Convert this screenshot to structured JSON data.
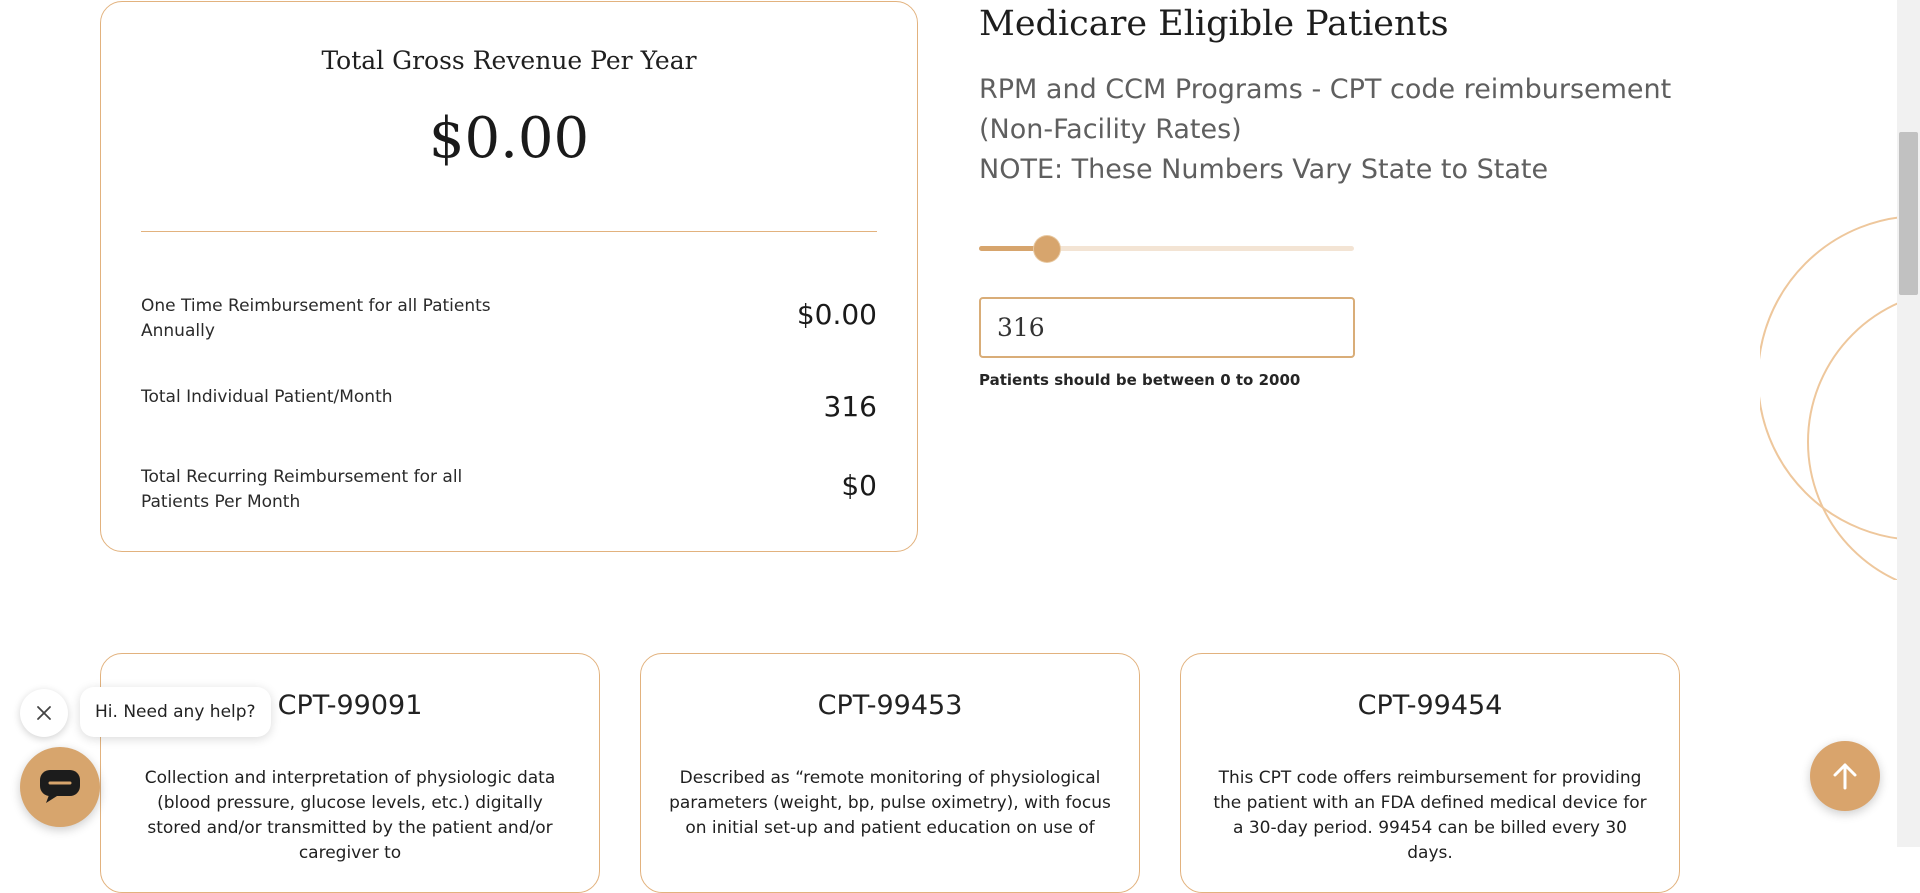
{
  "summary": {
    "title": "Total Gross Revenue Per Year",
    "amount": "$0.00",
    "rows": [
      {
        "label": "One Time Reimbursement for all Patients Annually",
        "value": "$0.00"
      },
      {
        "label": "Total Individual Patient/Month",
        "value": "316"
      },
      {
        "label": "Total Recurring Reimbursement for all Patients Per Month",
        "value": "$0"
      }
    ]
  },
  "medicare": {
    "title": "Medicare Eligible Patients",
    "program_line1": "RPM and CCM Programs - CPT code reimbursement (Non-Facility Rates)",
    "program_line2": "NOTE: These Numbers Vary State to State",
    "slider": {
      "min": 0,
      "max": 2000,
      "value": 316
    },
    "patients_value": "316",
    "hint": "Patients should be between 0 to 2000"
  },
  "cpt_cards": [
    {
      "code": "CPT-99091",
      "description": "Collection and interpretation of physiologic data (blood pressure, glucose levels, etc.) digitally stored and/or transmitted by the patient and/or caregiver to"
    },
    {
      "code": "CPT-99453",
      "description": "Described as “remote monitoring of physiological parameters (weight, bp, pulse oximetry), with focus on initial set-up and patient education on use of"
    },
    {
      "code": "CPT-99454",
      "description": "This CPT code offers reimbursement for providing the patient with an FDA defined medical device for a 30-day period. 99454 can be billed every 30 days."
    }
  ],
  "chat": {
    "greeting": "Hi. Need any help?",
    "close_icon": "close-icon",
    "launcher_icon": "chat-icon"
  },
  "back_to_top_icon": "arrow-up-icon",
  "colors": {
    "accent": "#d7a56d",
    "border": "#e2b27e",
    "track": "#f3e4d4"
  }
}
